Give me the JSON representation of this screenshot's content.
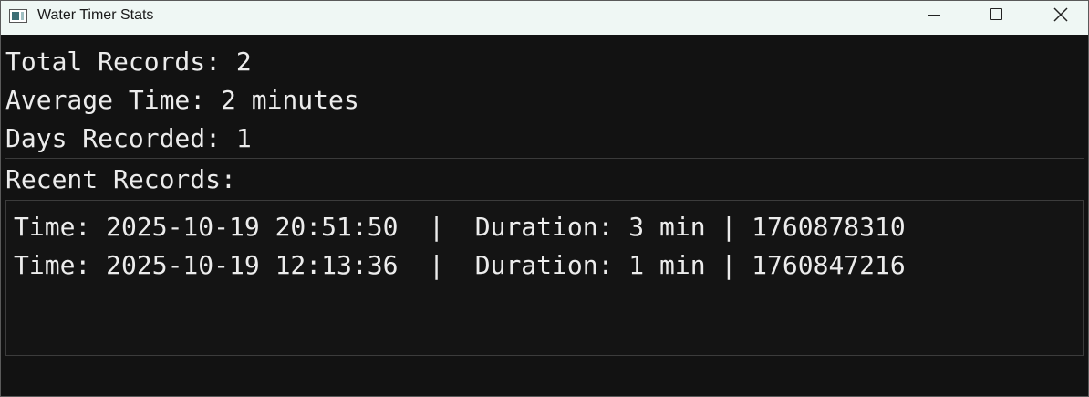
{
  "window": {
    "title": "Water Timer Stats",
    "icon": "app-window-icon",
    "controls": {
      "minimize_icon": "minimize-icon",
      "maximize_icon": "maximize-icon",
      "close_icon": "close-icon"
    }
  },
  "stats": {
    "total_records": "Total Records: 2",
    "average_time": "Average Time: 2 minutes",
    "days_recorded": "Days Recorded: 1"
  },
  "recent": {
    "label": "Recent Records:",
    "records": [
      "Time: 2025-10-19 20:51:50  |  Duration: 3 min | 1760878310",
      "Time: 2025-10-19 12:13:36  |  Duration: 1 min | 1760847216"
    ]
  },
  "colors": {
    "background": "#121212",
    "titlebar": "#eff7f4",
    "text": "#ececec"
  }
}
